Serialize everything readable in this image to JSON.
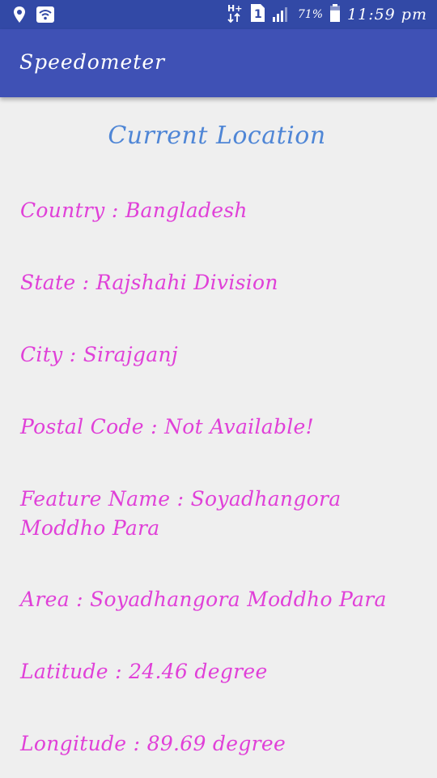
{
  "status_bar": {
    "battery_percent": "71%",
    "time": "11:59 pm",
    "network_label": "H+",
    "sim_label": "1",
    "icons": [
      "location-icon",
      "wifi-icon",
      "network-icon",
      "sim-icon",
      "signal-icon",
      "battery-icon"
    ]
  },
  "app_bar": {
    "title": "Speedometer",
    "color": "#3f51b5"
  },
  "main": {
    "heading": "Current Location",
    "items": [
      {
        "text": "Country : Bangladesh"
      },
      {
        "text": "State : Rajshahi Division"
      },
      {
        "text": "City : Sirajganj"
      },
      {
        "text": "Postal Code : Not Available!"
      },
      {
        "text": "Feature Name : Soyadhangora Moddho Para"
      },
      {
        "text": "Area : Soyadhangora Moddho Para"
      },
      {
        "text": "Latitude : 24.46 degree"
      },
      {
        "text": "Longitude : 89.69 degree"
      }
    ],
    "heading_color": "#4f86d6",
    "item_color": "#e040d8"
  }
}
